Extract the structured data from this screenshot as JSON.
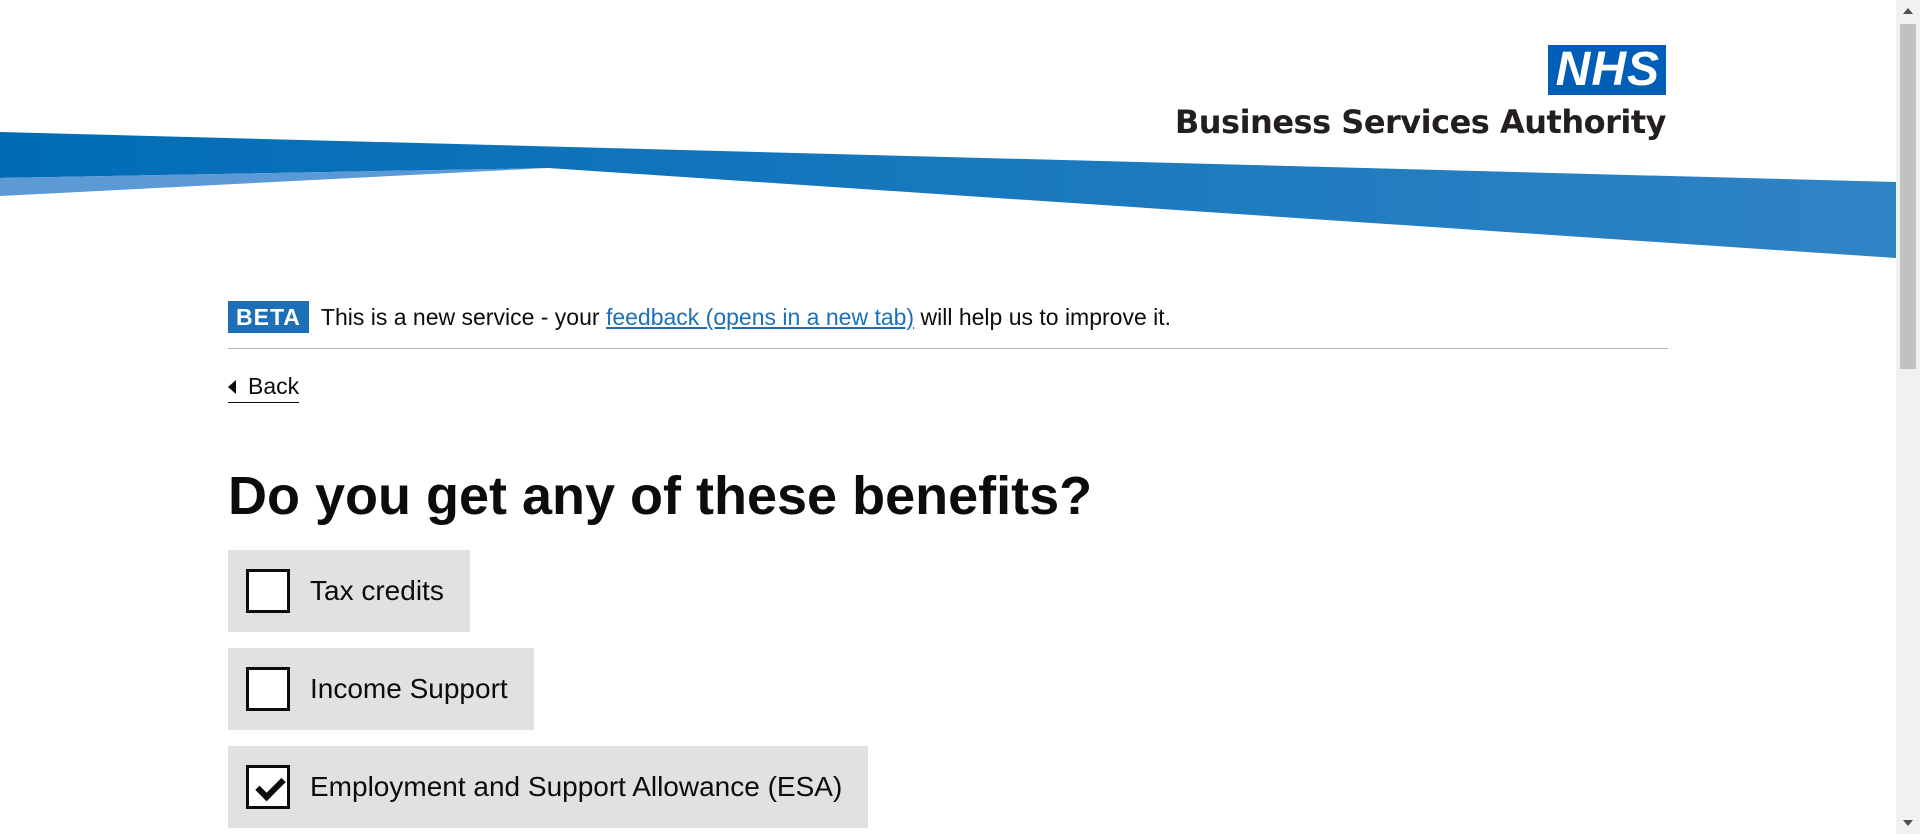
{
  "header": {
    "logo_mark": "NHS",
    "logo_text": "Business Services Authority"
  },
  "phase_banner": {
    "tag": "BETA",
    "text_before": "This is a new service - your ",
    "link_text": "feedback (opens in a new tab)",
    "text_after": " will help us to improve it."
  },
  "back_link": {
    "label": "Back"
  },
  "question": {
    "title": "Do you get any of these benefits?"
  },
  "options": [
    {
      "label": "Tax credits",
      "checked": false
    },
    {
      "label": "Income Support",
      "checked": false
    },
    {
      "label": "Employment and Support Allowance (ESA)",
      "checked": true
    }
  ],
  "colors": {
    "nhs_blue": "#005eb8",
    "link_blue": "#1d70b8",
    "option_background": "#e0e1e3"
  }
}
